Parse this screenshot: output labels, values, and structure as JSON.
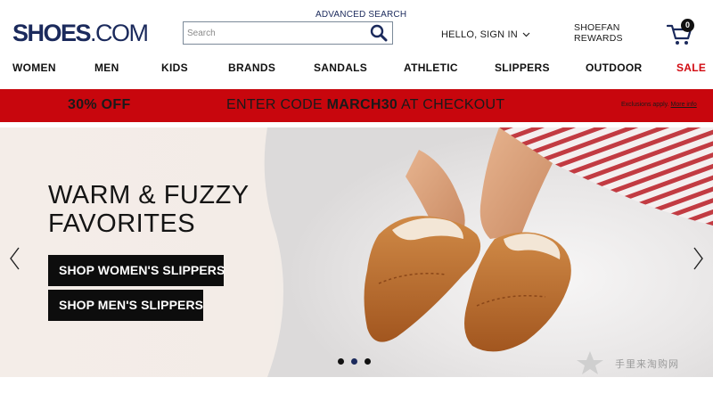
{
  "header": {
    "logo_bold": "SHOES",
    "logo_light": ".COM",
    "advanced_search": "ADVANCED SEARCH",
    "search_placeholder": "Search",
    "signin": "HELLO, SIGN IN",
    "rewards_line1": "SHOEFAN",
    "rewards_line2": "REWARDS",
    "cart_count": "0"
  },
  "nav": {
    "items": [
      "WOMEN",
      "MEN",
      "KIDS",
      "BRANDS",
      "SANDALS",
      "ATHLETIC",
      "SLIPPERS",
      "OUTDOOR",
      "SALE"
    ]
  },
  "promo": {
    "discount": "30% OFF",
    "code_prefix": "ENTER CODE ",
    "code": "MARCH30",
    "code_suffix": " AT CHECKOUT",
    "exclusions": "Exclusions apply.",
    "more_info": "More info"
  },
  "hero": {
    "title_line1": "WARM & FUZZY",
    "title_line2": "FAVORITES",
    "btn_women": "SHOP WOMEN'S SLIPPERS",
    "btn_men": "SHOP MEN'S SLIPPERS",
    "carousel_active_slide": 2,
    "carousel_total_slides": 3
  },
  "watermark": {
    "text": "手里来淘购网"
  },
  "colors": {
    "brand_navy": "#1b2a5c",
    "promo_red": "#c8060d",
    "sale_red": "#d10a11",
    "button_black": "#0d0d0d"
  },
  "icons": {
    "search": "search-icon",
    "cart": "cart-icon",
    "chevron": "chevron-down-icon",
    "prev": "chevron-left-icon",
    "next": "chevron-right-icon"
  }
}
